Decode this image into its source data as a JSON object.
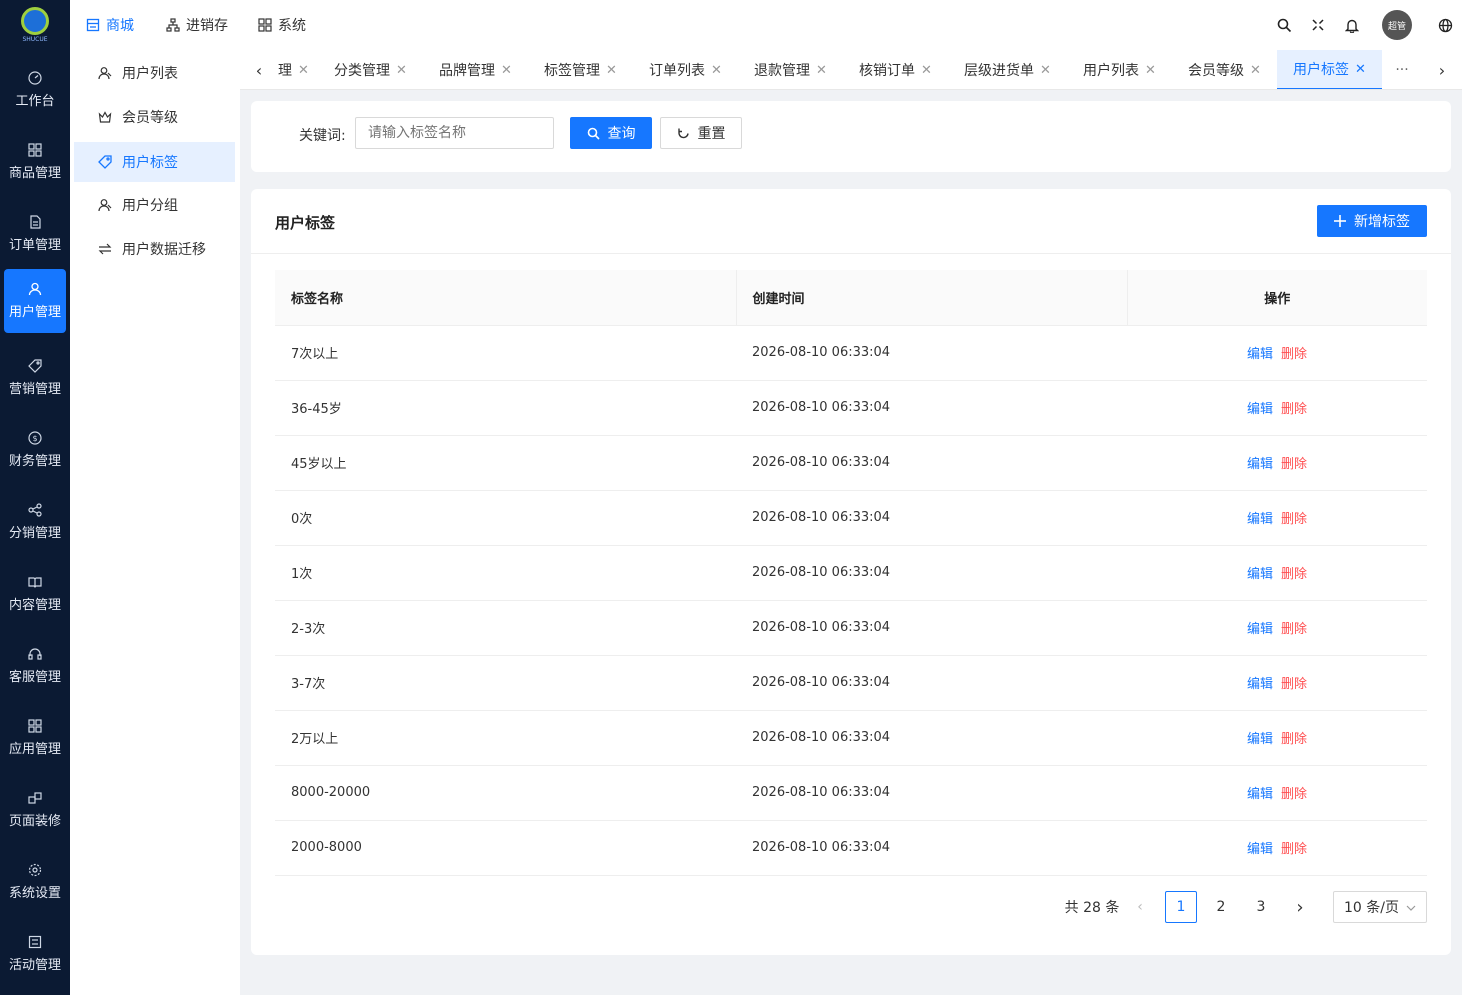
{
  "brand": {
    "logo_text": "SHUCUE"
  },
  "sidebar": {
    "items": [
      {
        "label": "工作台"
      },
      {
        "label": "商品管理"
      },
      {
        "label": "订单管理"
      },
      {
        "label": "用户管理"
      },
      {
        "label": "营销管理"
      },
      {
        "label": "财务管理"
      },
      {
        "label": "分销管理"
      },
      {
        "label": "内容管理"
      },
      {
        "label": "客服管理"
      },
      {
        "label": "应用管理"
      },
      {
        "label": "页面装修"
      },
      {
        "label": "系统设置"
      },
      {
        "label": "活动管理"
      }
    ],
    "active_index": 3
  },
  "submenu": {
    "items": [
      {
        "label": "用户列表"
      },
      {
        "label": "会员等级"
      },
      {
        "label": "用户标签"
      },
      {
        "label": "用户分组"
      },
      {
        "label": "用户数据迁移"
      }
    ],
    "active_index": 2
  },
  "topnav": {
    "items": [
      {
        "label": "商城"
      },
      {
        "label": "进销存"
      },
      {
        "label": "系统"
      }
    ],
    "active_index": 0,
    "avatar_text": "超管"
  },
  "tabs": {
    "items": [
      {
        "label": "理"
      },
      {
        "label": "分类管理"
      },
      {
        "label": "品牌管理"
      },
      {
        "label": "标签管理"
      },
      {
        "label": "订单列表"
      },
      {
        "label": "退款管理"
      },
      {
        "label": "核销订单"
      },
      {
        "label": "层级进货单"
      },
      {
        "label": "用户列表"
      },
      {
        "label": "会员等级"
      },
      {
        "label": "用户标签"
      }
    ],
    "active_index": 10,
    "more": "···"
  },
  "search": {
    "label": "关键词:",
    "placeholder": "请输入标签名称",
    "query_button": "查询",
    "reset_button": "重置"
  },
  "panel": {
    "title": "用户标签",
    "add_button": "新增标签"
  },
  "table": {
    "columns": [
      "标签名称",
      "创建时间",
      "操作"
    ],
    "edit_label": "编辑",
    "delete_label": "删除",
    "rows": [
      {
        "name": "7次以上",
        "created": "2026-08-10 06:33:04"
      },
      {
        "name": "36-45岁",
        "created": "2026-08-10 06:33:04"
      },
      {
        "name": "45岁以上",
        "created": "2026-08-10 06:33:04"
      },
      {
        "name": "0次",
        "created": "2026-08-10 06:33:04"
      },
      {
        "name": "1次",
        "created": "2026-08-10 06:33:04"
      },
      {
        "name": "2-3次",
        "created": "2026-08-10 06:33:04"
      },
      {
        "name": "3-7次",
        "created": "2026-08-10 06:33:04"
      },
      {
        "name": "2万以上",
        "created": "2026-08-10 06:33:04"
      },
      {
        "name": "8000-20000",
        "created": "2026-08-10 06:33:04"
      },
      {
        "name": "2000-8000",
        "created": "2026-08-10 06:33:04"
      }
    ]
  },
  "pagination": {
    "total": "共 28 条",
    "pages": [
      "1",
      "2",
      "3"
    ],
    "current": "1",
    "page_size": "10 条/页"
  },
  "colors": {
    "primary": "#1677ff",
    "danger": "#ff4d4f",
    "sidebar": "#0b1a33"
  }
}
